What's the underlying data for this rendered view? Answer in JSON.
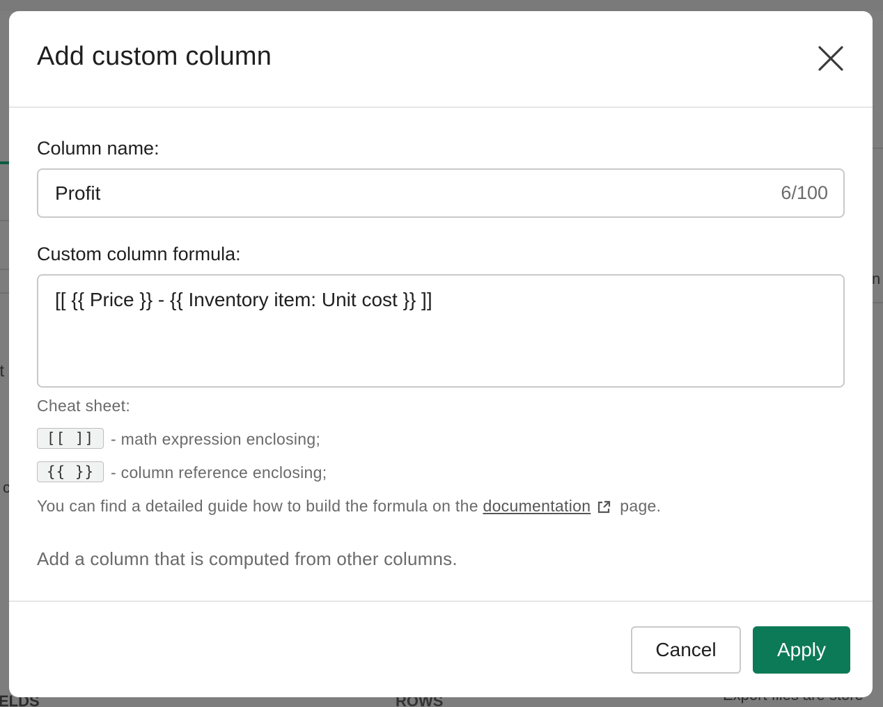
{
  "background": {
    "fragments": [
      "lt",
      "c",
      "n",
      "ELDS",
      "ROWS",
      "Export files are store"
    ]
  },
  "modal": {
    "title": "Add custom column",
    "close_icon": "close-icon",
    "column_name": {
      "label": "Column name:",
      "value": "Profit",
      "counter": "6/100"
    },
    "formula": {
      "label": "Custom column formula:",
      "value": "[[ {{ Price }} - {{ Inventory item: Unit cost }} ]]"
    },
    "cheat_sheet": {
      "title": "Cheat sheet:",
      "items": [
        {
          "code": "[[  ]]",
          "description": "- math expression enclosing;"
        },
        {
          "code": "{{  }}",
          "description": "- column reference enclosing;"
        }
      ],
      "guide_prefix": "You can find a detailed guide how to build the formula on the",
      "guide_link": "documentation",
      "guide_suffix": "page.",
      "link_icon": "external-link-icon"
    },
    "description": "Add a column that is computed from other columns.",
    "buttons": {
      "cancel": "Cancel",
      "apply": "Apply"
    }
  },
  "colors": {
    "accent": "#0d7a57",
    "overlay": "#7d7d7d"
  }
}
